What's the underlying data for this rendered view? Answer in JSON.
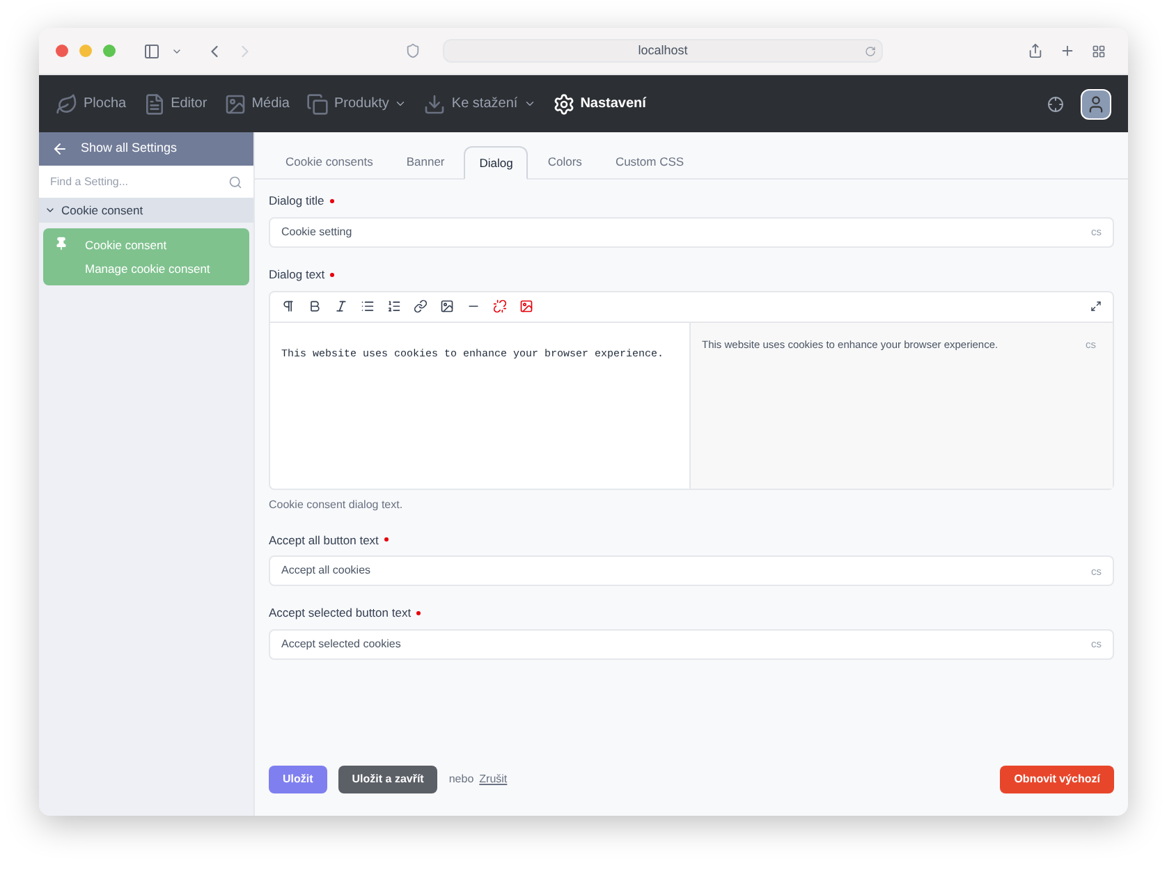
{
  "browser": {
    "address": "localhost"
  },
  "nav": [
    {
      "label": "Plocha",
      "dropdown": false,
      "selected": false
    },
    {
      "label": "Editor",
      "dropdown": false,
      "selected": false
    },
    {
      "label": "Média",
      "dropdown": false,
      "selected": false
    },
    {
      "label": "Produkty",
      "dropdown": true,
      "selected": false
    },
    {
      "label": "Ke stažení",
      "dropdown": true,
      "selected": false
    },
    {
      "label": "Nastavení",
      "dropdown": false,
      "selected": true
    }
  ],
  "sidebar": {
    "back": "Show all Settings",
    "search_placeholder": "Find a Setting...",
    "group": {
      "label": "Cookie consent",
      "expanded": true
    },
    "items": [
      {
        "title": "Cookie consent",
        "subtitle": "Manage cookie consent",
        "selected": true
      }
    ]
  },
  "tabs": [
    {
      "label": "Cookie consents",
      "selected": false
    },
    {
      "label": "Banner",
      "selected": false
    },
    {
      "label": "Dialog",
      "selected": true
    },
    {
      "label": "Colors",
      "selected": false
    },
    {
      "label": "Custom CSS",
      "selected": false
    }
  ],
  "fields": [
    {
      "kind": "input",
      "label": "Dialog title",
      "required": true,
      "value": "Cookie setting",
      "lang": "cs"
    },
    {
      "kind": "editor",
      "label": "Dialog text",
      "required": true,
      "value": "This website uses cookies to enhance your browser experience.",
      "preview": "This website uses cookies to enhance your browser experience.",
      "lang": "cs",
      "help": "Cookie consent dialog text."
    },
    {
      "kind": "input",
      "label": "Accept all button text",
      "required": true,
      "value": "Accept all cookies",
      "lang": "cs"
    },
    {
      "kind": "input",
      "label": "Accept selected button text",
      "required": true,
      "value": "Accept selected cookies",
      "lang": "cs"
    }
  ],
  "actions": {
    "save": "Uložit",
    "save_close": "Uložit a zavřít",
    "or": "nebo",
    "cancel": "Zrušit",
    "reset": "Obnovit výchozí"
  }
}
